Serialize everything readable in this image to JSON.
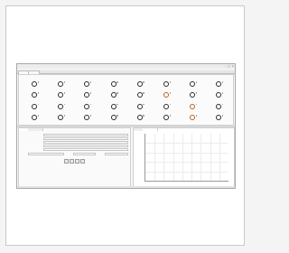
{
  "window": {
    "title": "",
    "controls": [
      "–",
      "□",
      "×"
    ]
  },
  "menu": [
    "",
    "",
    "",
    ""
  ],
  "tabs": [
    "",
    ""
  ],
  "plate": {
    "rows": 4,
    "cols": 8,
    "warm_wells": [
      [
        1,
        5
      ],
      [
        2,
        6
      ],
      [
        3,
        6
      ]
    ],
    "colors": {
      "well": "#2a2a2a",
      "warm": "#b8601e"
    }
  },
  "left_panel": {
    "tabs": [
      "",
      ""
    ],
    "fields": [
      "",
      "",
      "",
      "",
      ""
    ],
    "bottom_labels": [
      "",
      "",
      ""
    ]
  },
  "right_panel": {
    "tabs": [
      "",
      ""
    ]
  },
  "chart_data": {
    "type": "line",
    "title": "",
    "xlabel": "",
    "ylabel": "",
    "x_ticks": [
      "",
      "",
      "",
      "",
      "",
      "",
      "",
      "",
      ""
    ],
    "y_ticks_left": [
      "",
      "",
      "",
      "",
      ""
    ],
    "y_ticks_right": [
      "",
      "",
      "",
      ""
    ],
    "series": [],
    "grid": true
  }
}
